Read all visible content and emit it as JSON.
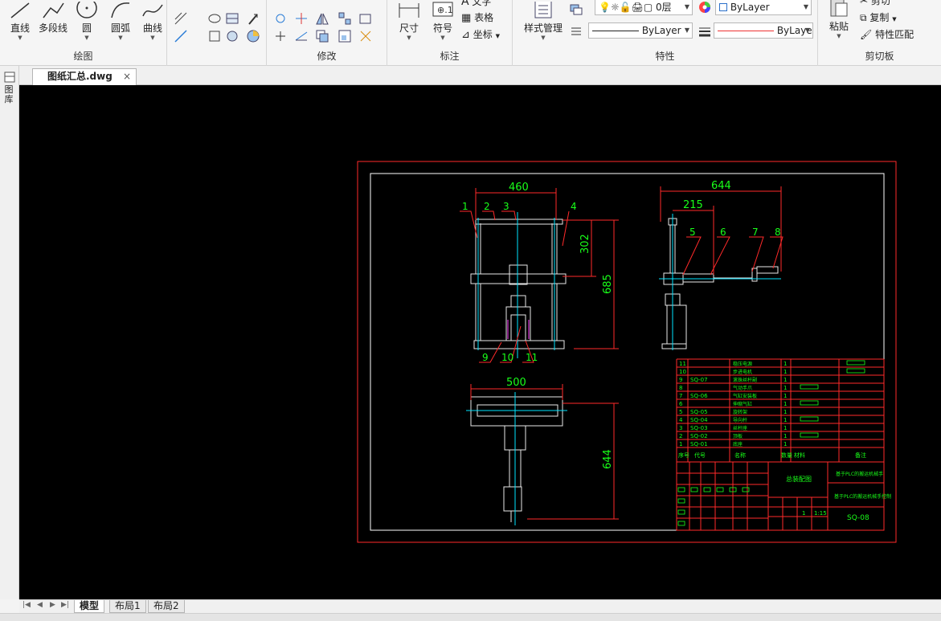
{
  "ribbon": {
    "draw": {
      "title": "绘图",
      "tools": [
        "直线",
        "多段线",
        "圆",
        "圆弧",
        "曲线"
      ]
    },
    "modify": {
      "title": "修改"
    },
    "annotate": {
      "title": "标注",
      "dimension": "尺寸",
      "symbol": "符号",
      "text": "文字",
      "table": "表格",
      "coordinate": "坐标"
    },
    "properties": {
      "title": "特性",
      "style_manager": "样式管理",
      "layer_name": "0层",
      "color_value": "ByLayer",
      "linetype_value": "ByLayer",
      "lineweight_value": "ByLayer"
    },
    "clipboard": {
      "title": "剪切板",
      "paste": "粘贴",
      "cut": "剪切",
      "copy": "复制",
      "match_props": "特性匹配"
    }
  },
  "document": {
    "tab_name": "图纸汇总.dwg",
    "close": "×"
  },
  "left_panel": {
    "label": "图库"
  },
  "layout_tabs": [
    "模型",
    "布局1",
    "布局2"
  ],
  "nav_arrows": [
    "|◀",
    "◀",
    "▶",
    "▶|"
  ],
  "drawing": {
    "dims": {
      "front_width": "460",
      "front_upper": "302",
      "front_height": "685",
      "side_width": "644",
      "side_inner": "215",
      "top_width": "500",
      "top_height": "644"
    },
    "balloons_front": [
      "1",
      "2",
      "3",
      "4"
    ],
    "balloons_front_bottom": [
      "9",
      "10",
      "11"
    ],
    "balloons_side": [
      "5",
      "6",
      "7",
      "8"
    ],
    "bom_rows": [
      {
        "no": "11",
        "code": "",
        "name": "稳压电源",
        "qty": "1"
      },
      {
        "no": "10",
        "code": "",
        "name": "步进电机",
        "qty": "1"
      },
      {
        "no": "9",
        "code": "SQ-07",
        "name": "滚珠丝杆副",
        "qty": "1"
      },
      {
        "no": "8",
        "code": "",
        "name": "气动手爪",
        "qty": "1"
      },
      {
        "no": "7",
        "code": "SQ-06",
        "name": "气缸安装板",
        "qty": "1"
      },
      {
        "no": "6",
        "code": "",
        "name": "伸缩气缸",
        "qty": "1"
      },
      {
        "no": "5",
        "code": "SQ-05",
        "name": "旋转架",
        "qty": "1"
      },
      {
        "no": "4",
        "code": "SQ-04",
        "name": "导向杆",
        "qty": "1"
      },
      {
        "no": "3",
        "code": "SQ-03",
        "name": "丝杆座",
        "qty": "1"
      },
      {
        "no": "2",
        "code": "SQ-02",
        "name": "顶板",
        "qty": "1"
      },
      {
        "no": "1",
        "code": "SQ-01",
        "name": "底座",
        "qty": "1"
      }
    ],
    "bom_header": [
      "序号",
      "代号",
      "名称",
      "数量",
      "材料",
      "备注"
    ],
    "title_block": {
      "part_name": "总装配图",
      "project_1": "基于PLC的搬运机械手",
      "project_2": "基于PLC的搬运机械手控制",
      "scale": "1:15",
      "sheet_qty": "1",
      "drawing_no": "SQ-08"
    }
  },
  "colors": {
    "frame_red": "#ff2a2a",
    "border_white": "#ffffff",
    "dim_green": "#19ff19",
    "part_white": "#e8e8e8",
    "center_cyan": "#00e5ff",
    "hatch_magenta": "#ff40ff"
  }
}
